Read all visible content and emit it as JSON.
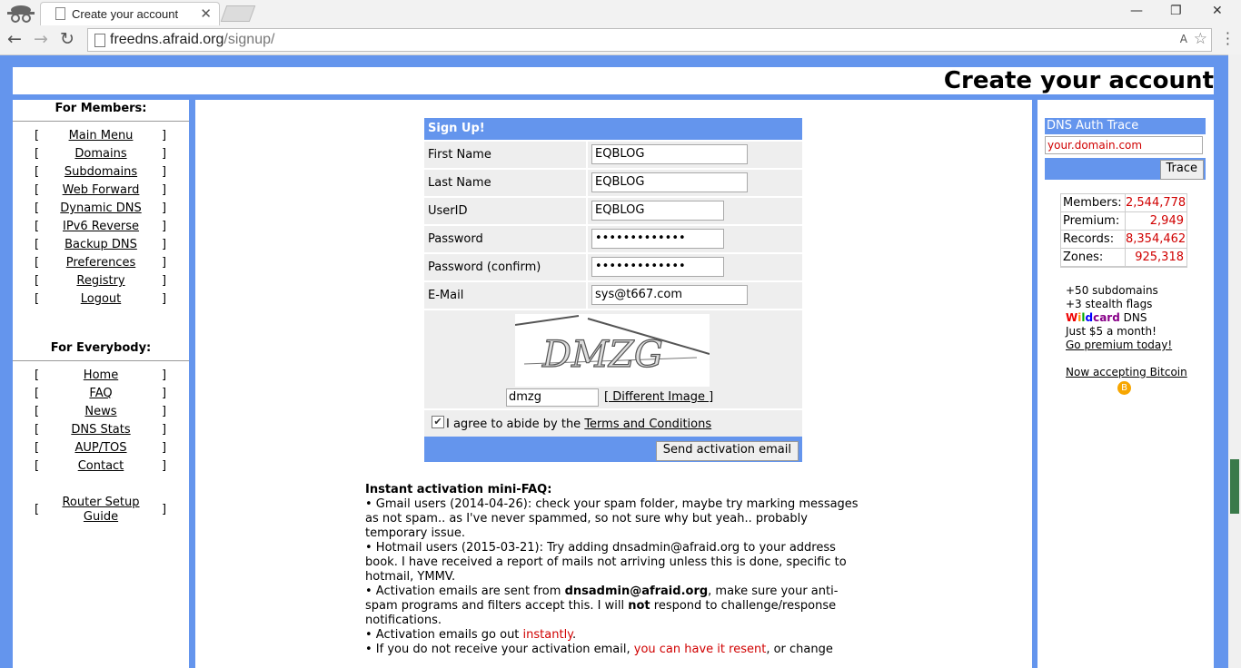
{
  "browser": {
    "tab_title": "Create your account",
    "tab_close": "✕",
    "url_host": "freedns.afraid.org",
    "url_path": "/signup/",
    "win_min": "—",
    "win_max": "❐",
    "win_close": "✕",
    "nav_back": "←",
    "nav_forward": "→",
    "nav_reload": "↻",
    "star": "☆",
    "translate": "A"
  },
  "header": {
    "title": "Create your account"
  },
  "left": {
    "members_heading": "For Members:",
    "members": [
      "Main Menu",
      "Domains",
      "Subdomains",
      "Web Forward",
      "Dynamic DNS",
      "IPv6 Reverse",
      "Backup DNS",
      "Preferences",
      "Registry",
      "Logout"
    ],
    "everybody_heading": "For Everybody:",
    "everybody": [
      "Home",
      "FAQ",
      "News",
      "DNS Stats",
      "AUP/TOS",
      "Contact"
    ],
    "router_line1": "Router Setup",
    "router_line2": "Guide",
    "bracket_l": "[",
    "bracket_r": "]"
  },
  "signup": {
    "heading": "Sign Up!",
    "fields": [
      {
        "label": "First Name",
        "value": "EQBLOG"
      },
      {
        "label": "Last Name",
        "value": "EQBLOG"
      },
      {
        "label": "UserID",
        "value": "EQBLOG"
      },
      {
        "label": "Password",
        "value": "•••••••••••••"
      },
      {
        "label": "Password (confirm)",
        "value": "•••••••••••••"
      },
      {
        "label": "E-Mail",
        "value": "sys@t667.com"
      }
    ],
    "captcha_text": "DMZG",
    "captcha_value": "dmzg",
    "different_image": "[ Different Image ]",
    "agree_text": "I agree to abide by the ",
    "terms": "Terms and Conditions",
    "checkmark": "✔",
    "send_button": "Send activation email"
  },
  "faq": {
    "title": "Instant activation mini-FAQ:",
    "gmail": "• Gmail users (2014-04-26): check your spam folder, maybe try marking messages as not spam.. as I've never spammed, so not sure why but yeah.. probably temporary issue.",
    "hotmail": "• Hotmail users (2015-03-21): Try adding dnsadmin@afraid.org to your address book. I have received a report of mails not arriving unless this is done, specific to hotmail, YMMV.",
    "act_pre": "• Activation emails are sent from ",
    "act_email": "dnsadmin@afraid.org",
    "act_mid": ", make sure your anti-spam programs and filters accept this. I will ",
    "act_not": "not",
    "act_post": " respond to challenge/response notifications.",
    "go_pre": "• Activation emails go out ",
    "go_instantly": "instantly",
    "go_post": ".",
    "resend_pre": "• If you do not receive your activation email, ",
    "resend_link": "you can have it resent",
    "resend_post": ", or change"
  },
  "right": {
    "dns_heading": "DNS Auth Trace",
    "dns_placeholder": "your.domain.com",
    "trace_button": "Trace",
    "stats": [
      {
        "k": "Members:",
        "v": "2,544,778"
      },
      {
        "k": "Premium:",
        "v": "2,949"
      },
      {
        "k": "Records:",
        "v": "8,354,462"
      },
      {
        "k": "Zones:",
        "v": "925,318"
      }
    ],
    "promo1": "+50 subdomains",
    "promo2": "+3 stealth flags",
    "wild_w": "W",
    "wild_i": "i",
    "wild_l": "l",
    "wild_d": "d",
    "wild_rest": "card",
    "dns_word": " DNS",
    "promo4": "Just $5 a month!",
    "promo5": "Go premium today!",
    "bitcoin": "Now accepting Bitcoin",
    "btc_symbol": "B"
  },
  "colors": {
    "accent": "#6495ED",
    "link_red": "#d00000"
  }
}
